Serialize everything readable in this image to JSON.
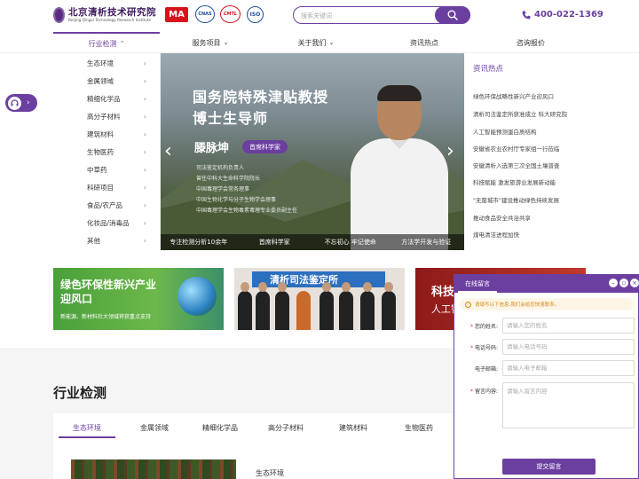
{
  "header": {
    "logo_cn": "北京清析技术研究院",
    "logo_en": "Beijing Qingxi Technology Research Institute",
    "certs": [
      "MA",
      "CNAS",
      "CMTL",
      "ISO"
    ],
    "search_placeholder": "搜索关键词",
    "phone": "400-022-1369"
  },
  "nav": {
    "items": [
      {
        "label": "行业检测",
        "chevron": "^"
      },
      {
        "label": "服务项目",
        "chevron": "v"
      },
      {
        "label": "关于我们",
        "chevron": "v"
      },
      {
        "label": "资讯热点",
        "chevron": ""
      },
      {
        "label": "咨询报价",
        "chevron": ""
      }
    ]
  },
  "category_menu": {
    "items": [
      "生态环境",
      "金属领域",
      "精细化学品",
      "高分子材料",
      "建筑材料",
      "生物医药",
      "中草药",
      "科研项目",
      "食品/农产品",
      "化妆品/消毒品",
      "其他"
    ]
  },
  "banner": {
    "title_line1": "国务院特殊津贴教授",
    "title_line2": "博士生导师",
    "name": "滕脉坤",
    "tag": "首席科学家",
    "lines": [
      "司法鉴定机构负责人",
      "曾任中科大生命科学院院长",
      "中国毒理学会常务理事",
      "中国生物化学与分子生物学会理事",
      "中国毒理学会生物毒素毒理专业委员副主任"
    ],
    "tabs": [
      "专注检测分析10余年",
      "首席科学家",
      "不忘初心 牢记使命",
      "方法学开发与验证"
    ]
  },
  "news": {
    "title": "资讯热点",
    "items": [
      "绿色环保战略性新兴产业迎风口",
      "清析司法鉴定所获准成立 科大研究院",
      "人工智能预测蛋白质结构",
      "安徽省农业农村厅专家组一行莅临",
      "安徽清析入选第三次全国土壤普查",
      "科技赋能 激发旅游业发展新动能",
      "\"无废城市\"建设推动绿色持续发展",
      "推动食品安全共治共享",
      "煤电清洁进程加快"
    ]
  },
  "promos": {
    "p1_line1": "绿色环保性新兴产业",
    "p1_line2": "迎风口",
    "p1_sub": "新能源、新材料杜大领域将获重点支持",
    "p2_title": "清析司法鉴定所",
    "p3_line1": "科技",
    "p3_line2": "人工智"
  },
  "section": {
    "title": "行业检测",
    "tabs": [
      "生态环境",
      "金属领域",
      "精细化学品",
      "高分子材料",
      "建筑材料",
      "生物医药"
    ],
    "content_label": "生态环境"
  },
  "chat": {
    "tab": "在线留言",
    "notice": "请填写以下信息,我们会给您快速联系。",
    "fields": [
      {
        "label": "您的姓名:",
        "placeholder": "请输入您的姓名",
        "required": true
      },
      {
        "label": "电话号码:",
        "placeholder": "请输入电话号码",
        "required": true
      },
      {
        "label": "电子邮箱:",
        "placeholder": "请输入电子邮箱",
        "required": false
      }
    ],
    "message_label": "留言内容:",
    "message_placeholder": "请输入留言内容",
    "submit": "提交留言"
  },
  "colors": {
    "accent": "#6b3fa0"
  }
}
